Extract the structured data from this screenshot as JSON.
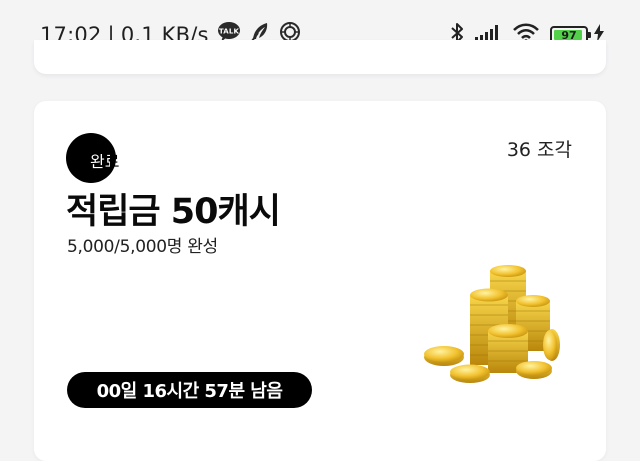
{
  "status_bar": {
    "time": "17:02",
    "separator": "|",
    "speed": "0.1 KB/s",
    "talk_icon_label": "TALK",
    "battery_level": "97",
    "icons": [
      "talk-icon",
      "feather-icon",
      "compass-icon",
      "bluetooth-icon",
      "signal-icon",
      "wifi-icon",
      "battery-icon",
      "charging-icon"
    ]
  },
  "mission": {
    "status_badge": "완료",
    "pieces": "36 조각",
    "title": "적립금 50캐시",
    "progress": "5,000/5,000명 완성",
    "time_left": "00일 16시간 57분 남음",
    "image": "gold-coins-icon"
  },
  "colors": {
    "background": "#f4f4f5",
    "card": "#ffffff",
    "accent": "#000000",
    "battery_green": "#53d04a",
    "coin_gold": "#e6b422"
  }
}
